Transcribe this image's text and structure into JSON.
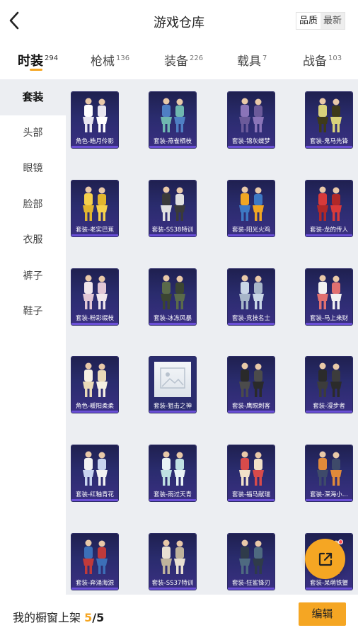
{
  "header": {
    "title": "游戏仓库",
    "back_icon": "chevron-left-icon",
    "sort_options": [
      "品质",
      "最新"
    ],
    "sort_active": "最新"
  },
  "tabs": [
    {
      "label": "时装",
      "count": "294",
      "active": true
    },
    {
      "label": "枪械",
      "count": "136",
      "active": false
    },
    {
      "label": "装备",
      "count": "226",
      "active": false
    },
    {
      "label": "载具",
      "count": "7",
      "active": false
    },
    {
      "label": "战备",
      "count": "103",
      "active": false
    }
  ],
  "sidebar": {
    "items": [
      {
        "label": "套装",
        "active": true
      },
      {
        "label": "头部",
        "active": false
      },
      {
        "label": "眼镜",
        "active": false
      },
      {
        "label": "脸部",
        "active": false
      },
      {
        "label": "衣服",
        "active": false
      },
      {
        "label": "裤子",
        "active": false
      },
      {
        "label": "鞋子",
        "active": false
      }
    ]
  },
  "items": [
    {
      "label": "角色-皓月伶影",
      "type": "figure",
      "colors": [
        "#ffffff",
        "#e8e6f0"
      ]
    },
    {
      "label": "套装-燕雀栖枝",
      "type": "figure",
      "colors": [
        "#4f7fc4",
        "#6fb7b0"
      ]
    },
    {
      "label": "套装-锦灰蝶梦",
      "type": "figure",
      "colors": [
        "#8a74b8",
        "#6b5a9a"
      ]
    },
    {
      "label": "套装-鬼马先锋",
      "type": "figure",
      "colors": [
        "#d9d27a",
        "#3e3a1a"
      ]
    },
    {
      "label": "套装-老实巴蕉",
      "type": "figure",
      "colors": [
        "#f5d04c",
        "#e2b52e"
      ]
    },
    {
      "label": "套装-SS38特训",
      "type": "figure",
      "colors": [
        "#3a3a3a",
        "#e0e0e0"
      ]
    },
    {
      "label": "套装-阳光火鸡",
      "type": "figure",
      "colors": [
        "#f0a623",
        "#3d79c4"
      ]
    },
    {
      "label": "套装-龙的传人",
      "type": "figure",
      "colors": [
        "#d83a3a",
        "#b02828"
      ]
    },
    {
      "label": "套装-粉彩缀枝",
      "type": "figure",
      "colors": [
        "#f0e6ec",
        "#e2c7d6"
      ]
    },
    {
      "label": "套装-冰冻风暴",
      "type": "figure",
      "colors": [
        "#5a6a4a",
        "#3b4532"
      ]
    },
    {
      "label": "套装-竞技名士",
      "type": "figure",
      "colors": [
        "#c9d6e6",
        "#a7b6c9"
      ]
    },
    {
      "label": "套装-马上来财",
      "type": "figure",
      "colors": [
        "#f1f1f1",
        "#e07070"
      ]
    },
    {
      "label": "角色-暖阳柔柔",
      "type": "figure",
      "colors": [
        "#f5efe2",
        "#e9d9b8"
      ]
    },
    {
      "label": "套装-狙击之神",
      "type": "placeholder",
      "colors": [
        "#dfe5ec",
        "#c5ced9"
      ]
    },
    {
      "label": "套装-鹰眼刺客",
      "type": "figure",
      "colors": [
        "#2a2a2a",
        "#4b4b4b"
      ]
    },
    {
      "label": "套装-漫步者",
      "type": "figure",
      "colors": [
        "#2b2b2b",
        "#3c3c3c"
      ]
    },
    {
      "label": "套装-红釉青花",
      "type": "figure",
      "colors": [
        "#f2f2f2",
        "#c8d4ef"
      ]
    },
    {
      "label": "套装-雨过天青",
      "type": "figure",
      "colors": [
        "#e9f3f5",
        "#bfe0e2"
      ]
    },
    {
      "label": "套装-福马献瑞",
      "type": "figure",
      "colors": [
        "#d84b4b",
        "#f1e1c8"
      ]
    },
    {
      "label": "套装-深海小...",
      "type": "figure",
      "colors": [
        "#e08a3a",
        "#3e4a6a"
      ]
    },
    {
      "label": "套装-奔涌海源",
      "type": "figure",
      "colors": [
        "#3c6fb8",
        "#c03a3a"
      ]
    },
    {
      "label": "套装-SS37特训",
      "type": "figure",
      "colors": [
        "#e8e0d2",
        "#bfb39c"
      ]
    },
    {
      "label": "套装-狂鲨锋刃",
      "type": "figure",
      "colors": [
        "#2f3b4a",
        "#4e6a80"
      ]
    },
    {
      "label": "套装-呆萌铁蟹",
      "type": "figure",
      "colors": [
        "#e15b3b",
        "#c64428"
      ]
    }
  ],
  "fab": {
    "icon": "share-external-icon",
    "badge": "notification-dot"
  },
  "bottom": {
    "prefix": "我的橱窗上架",
    "current": "5",
    "separator": "/",
    "total": "5",
    "edit_label": "编辑"
  },
  "colors": {
    "accent": "#f5a623",
    "card_bg": "#2a2c6e",
    "panel_bg": "#eceef2"
  }
}
